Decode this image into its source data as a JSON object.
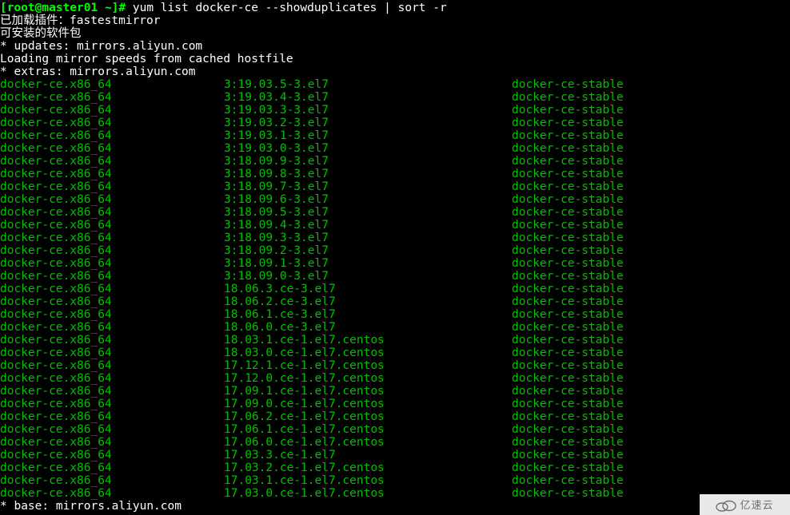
{
  "prompt": {
    "user_host": "[root@master01 ~]#",
    "command": "yum list docker-ce --showduplicates | sort -r"
  },
  "preamble": [
    {
      "class": "white",
      "text": "已加载插件：fastestmirror"
    },
    {
      "class": "white",
      "text": "可安装的软件包"
    },
    {
      "class": "white",
      "text": " * updates: mirrors.aliyun.com"
    },
    {
      "class": "white",
      "text": "Loading mirror speeds from cached hostfile"
    },
    {
      "class": "white",
      "text": " * extras: mirrors.aliyun.com"
    }
  ],
  "rows": [
    {
      "package": "docker-ce.x86_64",
      "version": "3:19.03.5-3.el7",
      "repo": "docker-ce-stable"
    },
    {
      "package": "docker-ce.x86_64",
      "version": "3:19.03.4-3.el7",
      "repo": "docker-ce-stable"
    },
    {
      "package": "docker-ce.x86_64",
      "version": "3:19.03.3-3.el7",
      "repo": "docker-ce-stable"
    },
    {
      "package": "docker-ce.x86_64",
      "version": "3:19.03.2-3.el7",
      "repo": "docker-ce-stable"
    },
    {
      "package": "docker-ce.x86_64",
      "version": "3:19.03.1-3.el7",
      "repo": "docker-ce-stable"
    },
    {
      "package": "docker-ce.x86_64",
      "version": "3:19.03.0-3.el7",
      "repo": "docker-ce-stable"
    },
    {
      "package": "docker-ce.x86_64",
      "version": "3:18.09.9-3.el7",
      "repo": "docker-ce-stable"
    },
    {
      "package": "docker-ce.x86_64",
      "version": "3:18.09.8-3.el7",
      "repo": "docker-ce-stable"
    },
    {
      "package": "docker-ce.x86_64",
      "version": "3:18.09.7-3.el7",
      "repo": "docker-ce-stable"
    },
    {
      "package": "docker-ce.x86_64",
      "version": "3:18.09.6-3.el7",
      "repo": "docker-ce-stable"
    },
    {
      "package": "docker-ce.x86_64",
      "version": "3:18.09.5-3.el7",
      "repo": "docker-ce-stable"
    },
    {
      "package": "docker-ce.x86_64",
      "version": "3:18.09.4-3.el7",
      "repo": "docker-ce-stable"
    },
    {
      "package": "docker-ce.x86_64",
      "version": "3:18.09.3-3.el7",
      "repo": "docker-ce-stable"
    },
    {
      "package": "docker-ce.x86_64",
      "version": "3:18.09.2-3.el7",
      "repo": "docker-ce-stable"
    },
    {
      "package": "docker-ce.x86_64",
      "version": "3:18.09.1-3.el7",
      "repo": "docker-ce-stable"
    },
    {
      "package": "docker-ce.x86_64",
      "version": "3:18.09.0-3.el7",
      "repo": "docker-ce-stable"
    },
    {
      "package": "docker-ce.x86_64",
      "version": "18.06.3.ce-3.el7",
      "repo": "docker-ce-stable"
    },
    {
      "package": "docker-ce.x86_64",
      "version": "18.06.2.ce-3.el7",
      "repo": "docker-ce-stable"
    },
    {
      "package": "docker-ce.x86_64",
      "version": "18.06.1.ce-3.el7",
      "repo": "docker-ce-stable"
    },
    {
      "package": "docker-ce.x86_64",
      "version": "18.06.0.ce-3.el7",
      "repo": "docker-ce-stable"
    },
    {
      "package": "docker-ce.x86_64",
      "version": "18.03.1.ce-1.el7.centos",
      "repo": "docker-ce-stable"
    },
    {
      "package": "docker-ce.x86_64",
      "version": "18.03.0.ce-1.el7.centos",
      "repo": "docker-ce-stable"
    },
    {
      "package": "docker-ce.x86_64",
      "version": "17.12.1.ce-1.el7.centos",
      "repo": "docker-ce-stable"
    },
    {
      "package": "docker-ce.x86_64",
      "version": "17.12.0.ce-1.el7.centos",
      "repo": "docker-ce-stable"
    },
    {
      "package": "docker-ce.x86_64",
      "version": "17.09.1.ce-1.el7.centos",
      "repo": "docker-ce-stable"
    },
    {
      "package": "docker-ce.x86_64",
      "version": "17.09.0.ce-1.el7.centos",
      "repo": "docker-ce-stable"
    },
    {
      "package": "docker-ce.x86_64",
      "version": "17.06.2.ce-1.el7.centos",
      "repo": "docker-ce-stable"
    },
    {
      "package": "docker-ce.x86_64",
      "version": "17.06.1.ce-1.el7.centos",
      "repo": "docker-ce-stable"
    },
    {
      "package": "docker-ce.x86_64",
      "version": "17.06.0.ce-1.el7.centos",
      "repo": "docker-ce-stable"
    },
    {
      "package": "docker-ce.x86_64",
      "version": "17.03.3.ce-1.el7",
      "repo": "docker-ce-stable"
    },
    {
      "package": "docker-ce.x86_64",
      "version": "17.03.2.ce-1.el7.centos",
      "repo": "docker-ce-stable"
    },
    {
      "package": "docker-ce.x86_64",
      "version": "17.03.1.ce-1.el7.centos",
      "repo": "docker-ce-stable"
    },
    {
      "package": "docker-ce.x86_64",
      "version": "17.03.0.ce-1.el7.centos",
      "repo": "docker-ce-stable"
    }
  ],
  "tail": [
    {
      "class": "white",
      "text": " * base: mirrors.aliyun.com"
    }
  ],
  "watermark": "亿速云"
}
